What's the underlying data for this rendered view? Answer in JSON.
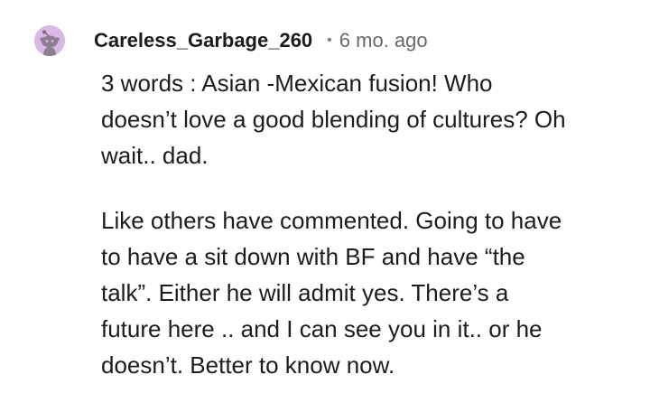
{
  "comment": {
    "author": "Careless_Garbage_260",
    "separator": "•",
    "time": "6 mo. ago",
    "avatar_icon": "reddit-snoo-avatar-icon",
    "avatar_color": "#d9b8e6",
    "paragraphs": [
      "3 words : Asian -Mexican fusion! Who\ndoesn’t love a good blending of cultures? Oh\nwait.. dad.",
      "Like others have commented. Going to have\nto have a sit down with BF and have “the\ntalk”. Either he will admit yes. There’s a\nfuture here .. and I can see you in it.. or he\ndoesn’t. Better to know now."
    ]
  }
}
